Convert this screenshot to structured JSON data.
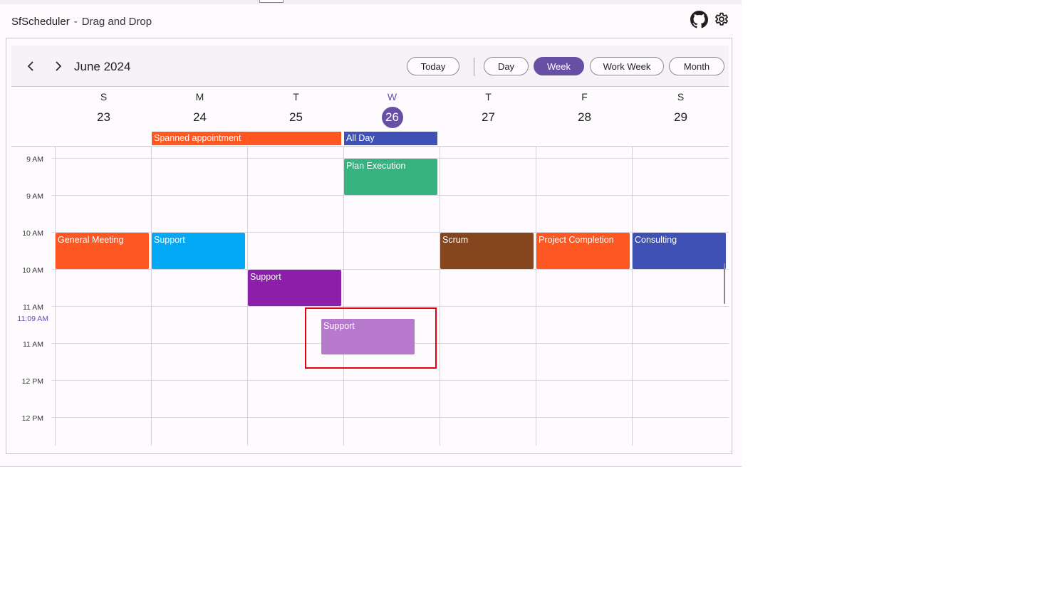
{
  "app": {
    "title": "SfScheduler",
    "separator": "-",
    "subtitle": "Drag and Drop",
    "icons": {
      "github": "github-icon",
      "settings": "gear-icon"
    }
  },
  "header": {
    "month_title": "June 2024",
    "prev_icon": "chevron-left-icon",
    "next_icon": "chevron-right-icon",
    "today_label": "Today",
    "views": [
      {
        "label": "Day",
        "active": false
      },
      {
        "label": "Week",
        "active": true
      },
      {
        "label": "Work Week",
        "active": false
      },
      {
        "label": "Month",
        "active": false
      }
    ]
  },
  "days": [
    {
      "dow": "S",
      "num": "23",
      "today": false
    },
    {
      "dow": "M",
      "num": "24",
      "today": false
    },
    {
      "dow": "T",
      "num": "25",
      "today": false
    },
    {
      "dow": "W",
      "num": "26",
      "today": true
    },
    {
      "dow": "T",
      "num": "27",
      "today": false
    },
    {
      "dow": "F",
      "num": "28",
      "today": false
    },
    {
      "dow": "S",
      "num": "29",
      "today": false
    }
  ],
  "time_labels": [
    "9 AM",
    "9 AM",
    "10 AM",
    "10 AM",
    "11 AM",
    "11 AM",
    "12 PM",
    "12 PM"
  ],
  "current_time": "11:09 AM",
  "all_day_events": [
    {
      "subject": "Spanned appointment",
      "color": "#ff5722"
    },
    {
      "subject": "All Day",
      "color": "#3f51b5"
    }
  ],
  "events": [
    {
      "subject": "Plan Execution",
      "color": "#36b37e"
    },
    {
      "subject": "General Meeting",
      "color": "#ff5722"
    },
    {
      "subject": "Support",
      "color": "#03a9f4"
    },
    {
      "subject": "Scrum",
      "color": "#85461e"
    },
    {
      "subject": "Project Completion",
      "color": "#ff5722"
    },
    {
      "subject": "Consulting",
      "color": "#3f51b5"
    },
    {
      "subject": "Support",
      "color": "#8b1fa9"
    }
  ],
  "drag_preview": {
    "subject": "Support",
    "color": "#b779cc"
  },
  "colors": {
    "accent": "#6750a4",
    "drag_outline": "#e4000f"
  }
}
